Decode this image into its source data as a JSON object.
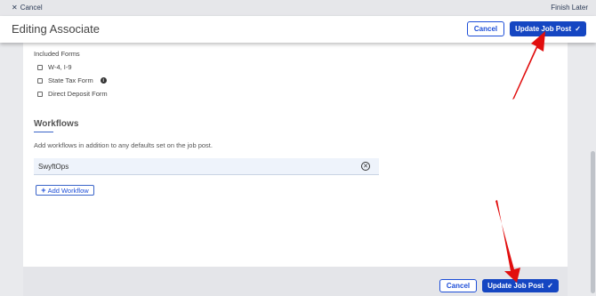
{
  "topbar": {
    "cancel_label": "Cancel",
    "finish_later_label": "Finish Later"
  },
  "header": {
    "title": "Editing Associate",
    "cancel_label": "Cancel",
    "update_label": "Update Job Post"
  },
  "forms": {
    "title": "Included Forms",
    "items": [
      {
        "label": "W-4, I-9"
      },
      {
        "label": "State Tax Form"
      },
      {
        "label": "Direct Deposit Form"
      }
    ]
  },
  "workflows": {
    "title": "Workflows",
    "description": "Add workflows in addition to any defaults set on the job post.",
    "items": [
      {
        "label": "SwyftOps"
      }
    ],
    "add_label": "Add Workflow"
  },
  "footer": {
    "cancel_label": "Cancel",
    "update_label": "Update Job Post"
  },
  "colors": {
    "primary": "#1546c2",
    "accent_arrow": "#e10e0e"
  },
  "icons": [
    "close-icon",
    "info-icon",
    "check-icon",
    "remove-circle-icon",
    "plus-icon"
  ]
}
